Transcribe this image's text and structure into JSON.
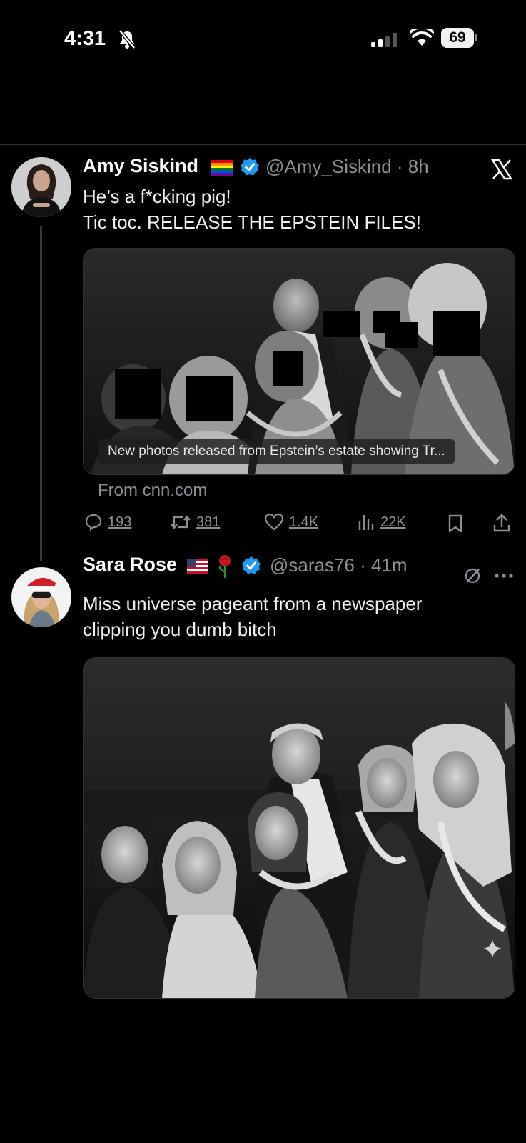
{
  "status_bar": {
    "time": "4:31",
    "battery": "69"
  },
  "tweet1": {
    "name": "Amy Siskind",
    "handle": "@Amy_Siskind",
    "time": "8h",
    "line1": "He’s a f*cking pig!",
    "line2": "Tic toc. RELEASE THE EPSTEIN FILES!",
    "card_caption": "New photos released from Epstein’s estate showing Tr...",
    "source": "From cnn.com",
    "replies": "193",
    "reposts": "381",
    "likes": "1.4K",
    "views": "22K"
  },
  "tweet2": {
    "name": "Sara Rose",
    "handle": "@saras76",
    "time": "41m",
    "line1": "Miss universe pageant from a newspaper",
    "line2": "clipping you dumb bitch"
  },
  "colors": {
    "verified": "#1d9bf0",
    "background": "#000000",
    "muted": "#8b9096"
  }
}
